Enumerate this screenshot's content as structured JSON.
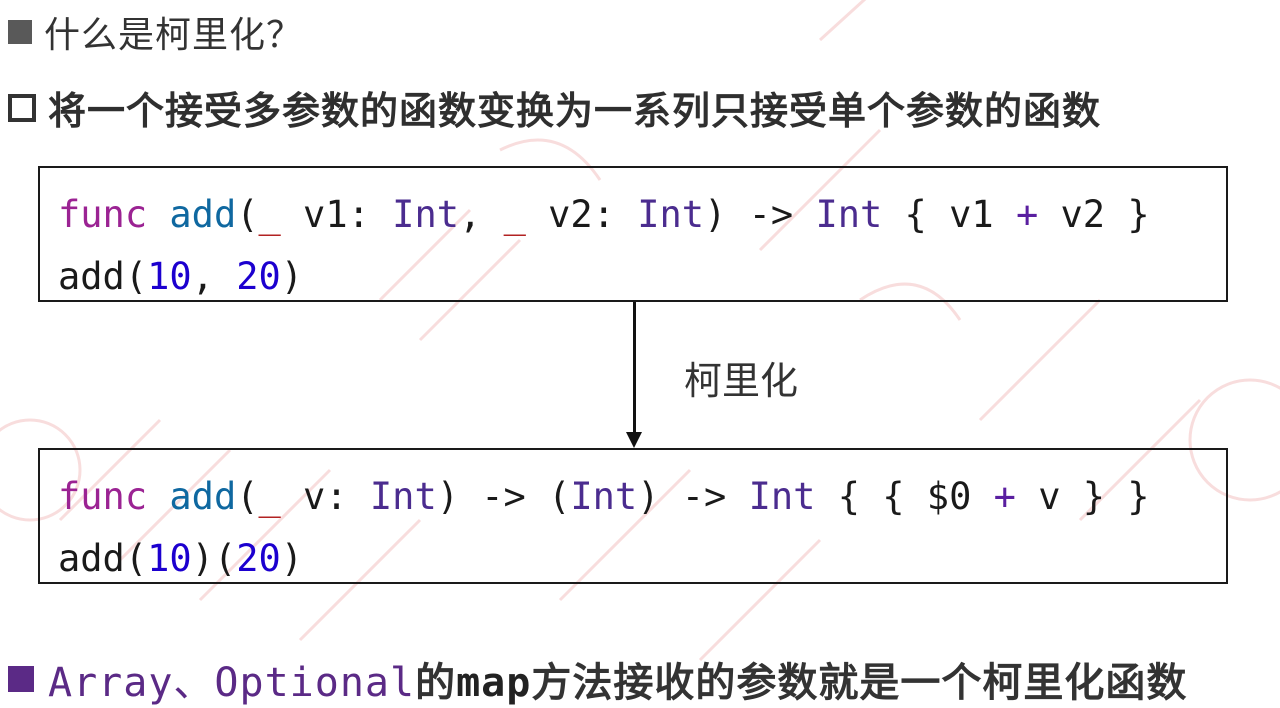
{
  "bullets": {
    "q": "什么是柯里化？",
    "definition": "将一个接受多参数的函数变换为一系列只接受单个参数的函数",
    "note": {
      "part1": "Array、Optional",
      "part2": "的",
      "part3": "map",
      "part4": "方法接收的参数就是一个柯里化函数"
    }
  },
  "code_before": {
    "line1": [
      {
        "t": "func",
        "c": "kw"
      },
      {
        "t": " ",
        "c": ""
      },
      {
        "t": "add",
        "c": "fn"
      },
      {
        "t": "(",
        "c": ""
      },
      {
        "t": "_",
        "c": "us"
      },
      {
        "t": " v1: ",
        "c": ""
      },
      {
        "t": "Int",
        "c": "ty"
      },
      {
        "t": ", ",
        "c": ""
      },
      {
        "t": "_",
        "c": "us"
      },
      {
        "t": " v2: ",
        "c": ""
      },
      {
        "t": "Int",
        "c": "ty"
      },
      {
        "t": ") -> ",
        "c": ""
      },
      {
        "t": "Int",
        "c": "ty"
      },
      {
        "t": " { v1 ",
        "c": ""
      },
      {
        "t": "+",
        "c": "op"
      },
      {
        "t": " v2 }",
        "c": ""
      }
    ],
    "line2": [
      {
        "t": "add(",
        "c": ""
      },
      {
        "t": "10",
        "c": "num"
      },
      {
        "t": ", ",
        "c": ""
      },
      {
        "t": "20",
        "c": "num"
      },
      {
        "t": ")",
        "c": ""
      }
    ]
  },
  "arrow_label": "柯里化",
  "code_after": {
    "line1": [
      {
        "t": "func",
        "c": "kw"
      },
      {
        "t": " ",
        "c": ""
      },
      {
        "t": "add",
        "c": "fn"
      },
      {
        "t": "(",
        "c": ""
      },
      {
        "t": "_",
        "c": "us"
      },
      {
        "t": " v: ",
        "c": ""
      },
      {
        "t": "Int",
        "c": "ty"
      },
      {
        "t": ") -> (",
        "c": ""
      },
      {
        "t": "Int",
        "c": "ty"
      },
      {
        "t": ") -> ",
        "c": ""
      },
      {
        "t": "Int",
        "c": "ty"
      },
      {
        "t": " { { $0 ",
        "c": ""
      },
      {
        "t": "+",
        "c": "op"
      },
      {
        "t": " v } }",
        "c": ""
      }
    ],
    "line2": [
      {
        "t": "add(",
        "c": ""
      },
      {
        "t": "10",
        "c": "num"
      },
      {
        "t": ")(",
        "c": ""
      },
      {
        "t": "20",
        "c": "num"
      },
      {
        "t": ")",
        "c": ""
      }
    ]
  },
  "colors": {
    "keyword": "#9b2393",
    "function": "#0f68a0",
    "type": "#4b2c8f",
    "number": "#1c00cf",
    "accent_purple": "#5b2a86",
    "watermark": "#e8a0a0"
  }
}
